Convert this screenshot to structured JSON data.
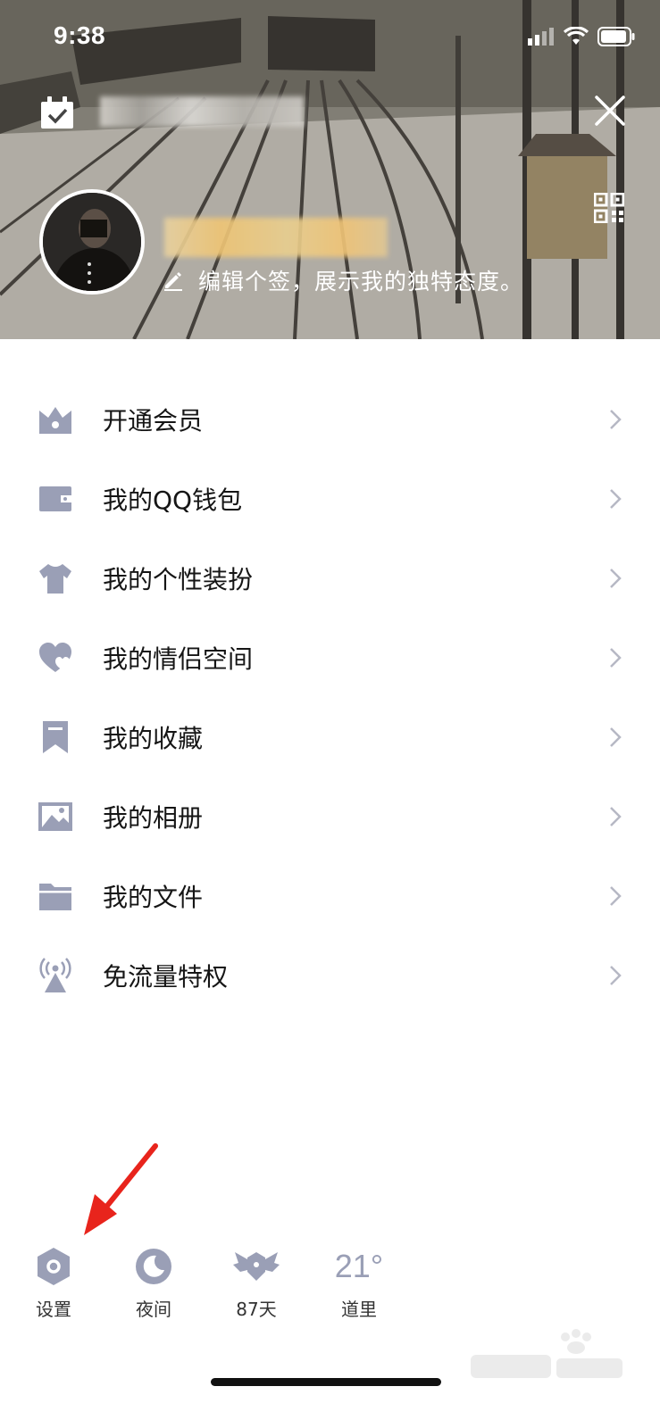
{
  "status_bar": {
    "time": "9:38"
  },
  "profile": {
    "signature": "编辑个签，展示我的独特态度。"
  },
  "menu": [
    {
      "label": "开通会员",
      "icon": "vip-crown-icon"
    },
    {
      "label": "我的QQ钱包",
      "icon": "wallet-icon"
    },
    {
      "label": "我的个性装扮",
      "icon": "tshirt-icon"
    },
    {
      "label": "我的情侣空间",
      "icon": "hearts-icon"
    },
    {
      "label": "我的收藏",
      "icon": "bookmark-icon"
    },
    {
      "label": "我的相册",
      "icon": "photo-icon"
    },
    {
      "label": "我的文件",
      "icon": "folder-icon"
    },
    {
      "label": "免流量特权",
      "icon": "signal-tower-icon"
    }
  ],
  "toolbar": {
    "settings_label": "设置",
    "night_label": "夜间",
    "days_label": "87天",
    "temperature": "21°",
    "city": "道里"
  },
  "colors": {
    "icon_gray": "#9a9fb6",
    "chevron_gray": "#b6b8c4",
    "arrow_red": "#e8241c"
  }
}
